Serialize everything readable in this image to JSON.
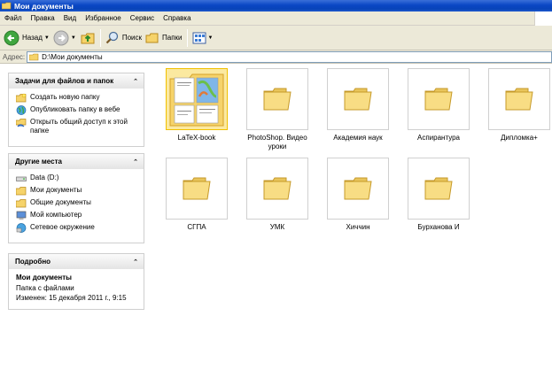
{
  "window": {
    "title": "Мои документы"
  },
  "menu": [
    "Файл",
    "Правка",
    "Вид",
    "Избранное",
    "Сервис",
    "Справка"
  ],
  "toolbar": {
    "back_label": "Назад",
    "search_label": "Поиск",
    "folders_label": "Папки"
  },
  "address": {
    "label": "Адрес:",
    "value": "D:\\Мои документы"
  },
  "tasks_panel": {
    "title": "Задачи для файлов и папок",
    "items": [
      {
        "label": "Создать новую папку",
        "icon": "new-folder-icon"
      },
      {
        "label": "Опубликовать папку в вебе",
        "icon": "web-publish-icon"
      },
      {
        "label": "Открыть общий доступ к этой папке",
        "icon": "share-icon"
      }
    ]
  },
  "places_panel": {
    "title": "Другие места",
    "items": [
      {
        "label": "Data (D:)",
        "icon": "drive-icon"
      },
      {
        "label": "Мои документы",
        "icon": "folder-icon"
      },
      {
        "label": "Общие документы",
        "icon": "folder-icon"
      },
      {
        "label": "Мой компьютер",
        "icon": "computer-icon"
      },
      {
        "label": "Сетевое окружение",
        "icon": "network-icon"
      }
    ]
  },
  "details_panel": {
    "title": "Подробно",
    "name": "Мои документы",
    "type": "Папка с файлами",
    "modified": "Изменен: 15 декабря 2011 г., 9:15"
  },
  "folders": [
    {
      "label": "LaTeX-book",
      "selected": true
    },
    {
      "label": "PhotoShop. Видео уроки",
      "selected": false
    },
    {
      "label": "Академия наук",
      "selected": false
    },
    {
      "label": "Аспирантура",
      "selected": false
    },
    {
      "label": "Дипломка+",
      "selected": false
    },
    {
      "label": "СГПА",
      "selected": false
    },
    {
      "label": "УМК",
      "selected": false
    },
    {
      "label": "Хиччин",
      "selected": false
    },
    {
      "label": "Бурханова И",
      "selected": false
    }
  ],
  "colors": {
    "titlebar": "#0a46c4",
    "chrome": "#ece9d8",
    "folder": "#f6d36a"
  }
}
